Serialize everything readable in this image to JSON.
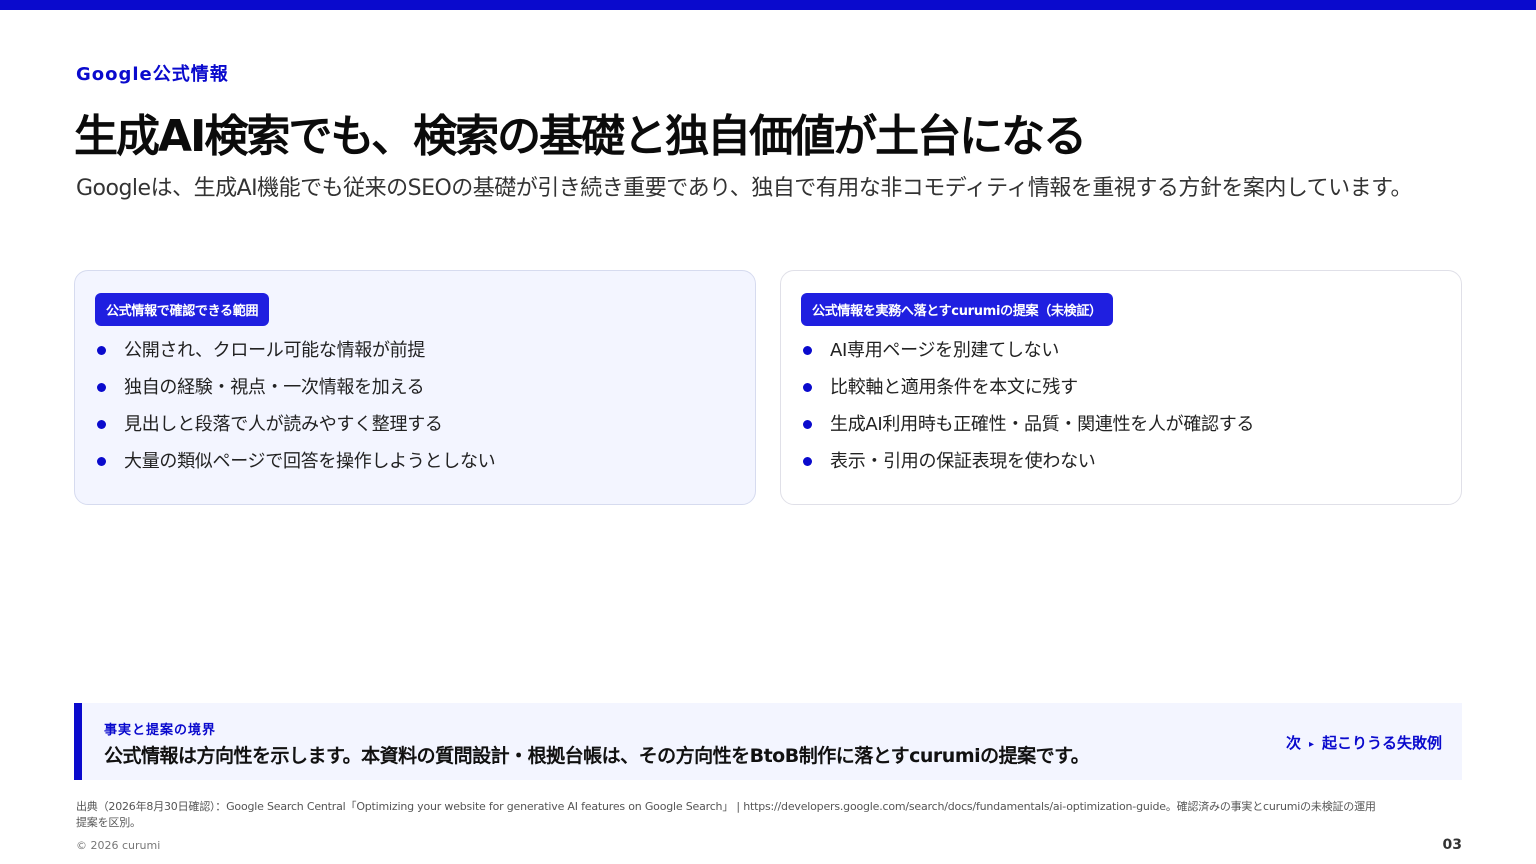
{
  "header": {
    "eyebrow": "Google公式情報",
    "title": "生成AI検索でも、検索の基礎と独自価値が土台になる",
    "lead": "Googleは、生成AI機能でも従来のSEOの基礎が引き続き重要であり、独自で有用な非コモディティ情報を重視する方針を案内しています。"
  },
  "cards": [
    {
      "tag": "公式情報で確認できる範囲",
      "items": [
        "公開され、クロール可能な情報が前提",
        "独自の経験・視点・一次情報を加える",
        "見出しと段落で人が読みやすく整理する",
        "大量の類似ページで回答を操作しようとしない"
      ]
    },
    {
      "tag": "公式情報を実務へ落とすcurumiの提案（未検証）",
      "items": [
        "AI専用ページを別建てしない",
        "比較軸と適用条件を本文に残す",
        "生成AI利用時も正確性・品質・関連性を人が確認する",
        "表示・引用の保証表現を使わない"
      ]
    }
  ],
  "callout": {
    "label": "事実と提案の境界",
    "text": "公式情報は方向性を示します。本資料の質問設計・根拠台帳は、その方向性をBtoB制作に落とすcurumiの提案です。",
    "next_prefix": "次",
    "next_arrow": "▸",
    "next_label": "起こりうる失敗例"
  },
  "footer": {
    "source": "出典（2026年8月30日確認）：Google Search Central「Optimizing your website for generative AI features on Google Search」 | https://developers.google.com/search/docs/fundamentals/ai-optimization-guide。確認済みの事実とcurumiの未検証の運用提案を区別。",
    "copyright": "© 2026 curumi",
    "page_number": "03"
  },
  "colors": {
    "accent": "#0a0acd",
    "card_tint": "#f3f5ff"
  }
}
